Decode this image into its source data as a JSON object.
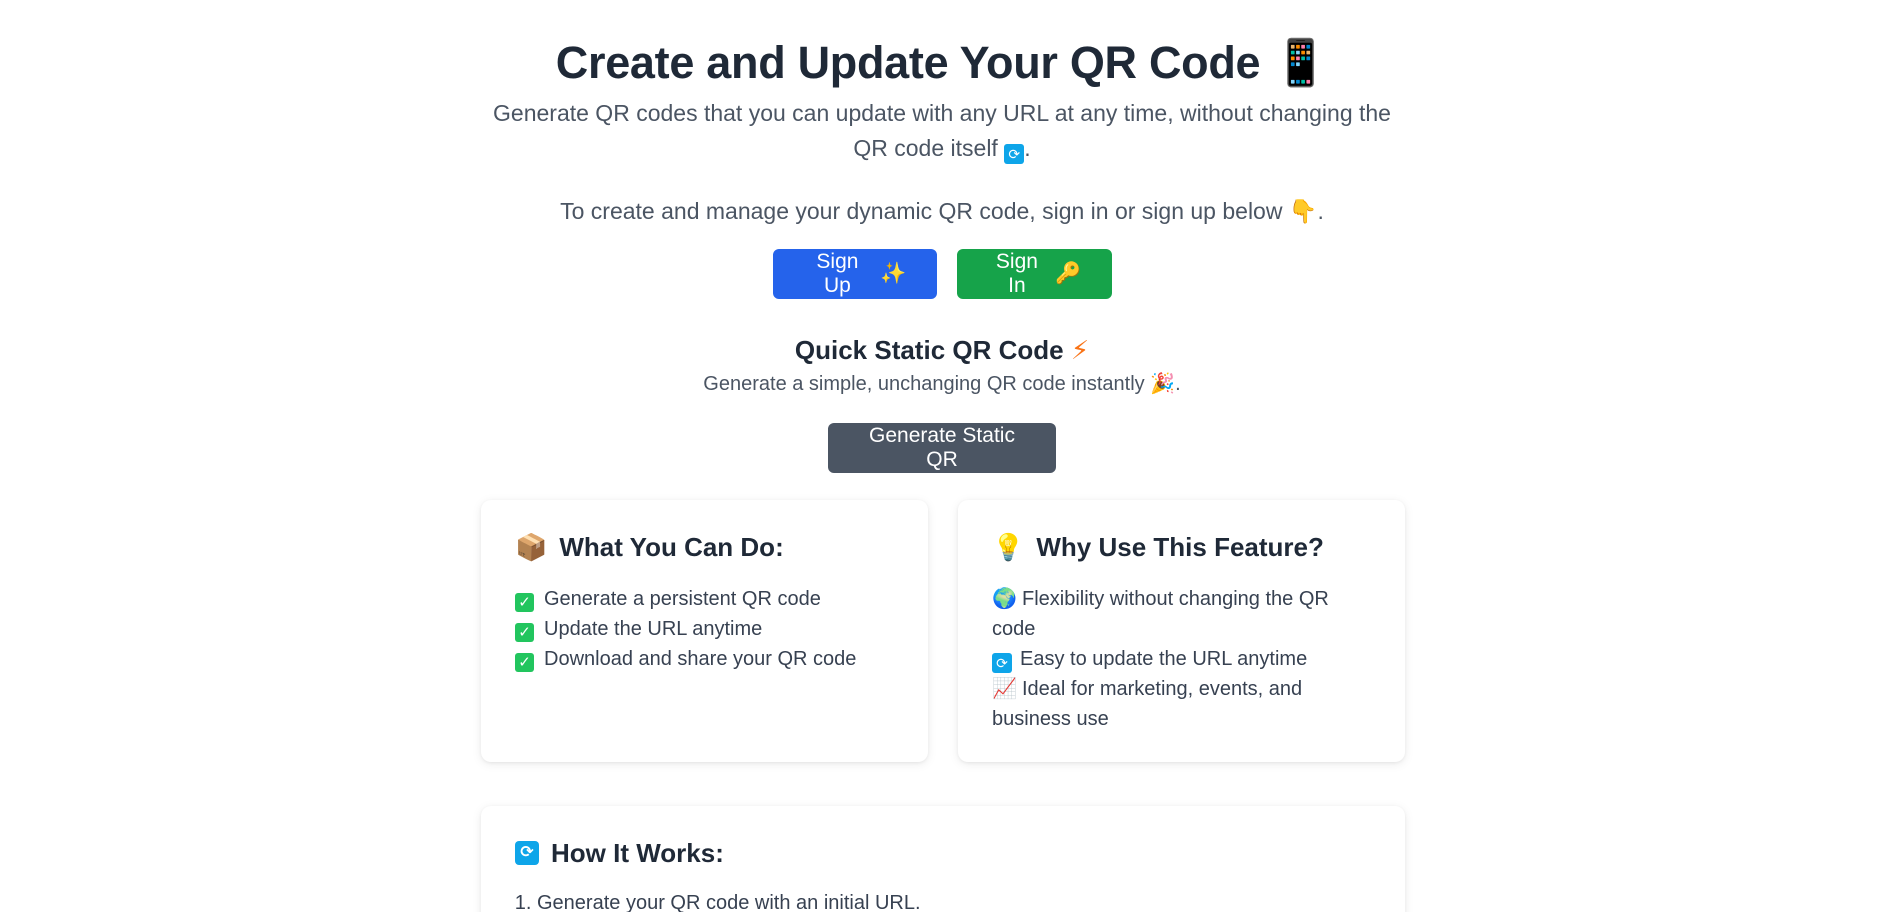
{
  "hero": {
    "title": "Create and Update Your QR Code",
    "title_icon": "📱",
    "subtitle": "Generate QR codes that you can update with any URL at any time, without changing the QR code itself",
    "subtitle_icon": "refresh-icon",
    "subtitle_end": ".",
    "cta_text": "To create and manage your dynamic QR code, sign in or sign up below",
    "cta_icon": "👇",
    "cta_end": "."
  },
  "buttons": {
    "signup_label": "Sign Up",
    "signup_icon": "✨",
    "signin_label": "Sign In",
    "signin_icon": "🔑"
  },
  "quick": {
    "title": "Quick Static QR Code",
    "title_icon": "⚡",
    "desc": "Generate a simple, unchanging QR code instantly",
    "desc_icon": "🎉",
    "desc_end": ".",
    "button_label": "Generate Static QR"
  },
  "what": {
    "icon": "📦",
    "title": "What You Can Do:",
    "items": [
      "Generate a persistent QR code",
      "Update the URL anytime",
      "Download and share your QR code"
    ]
  },
  "why": {
    "icon": "💡",
    "title": "Why Use This Feature?",
    "items": [
      {
        "icon": "🌍",
        "text": "Flexibility without changing the QR code"
      },
      {
        "icon": "refresh-icon",
        "text": "Easy to update the URL anytime"
      },
      {
        "icon": "📈",
        "text": "Ideal for marketing, events, and business use"
      }
    ]
  },
  "how": {
    "icon": "refresh-icon",
    "title": "How It Works:",
    "steps": [
      "Generate your QR code with an initial URL."
    ]
  },
  "colors": {
    "signup": "#2563eb",
    "signin": "#16a34a",
    "static": "#4b5563"
  }
}
